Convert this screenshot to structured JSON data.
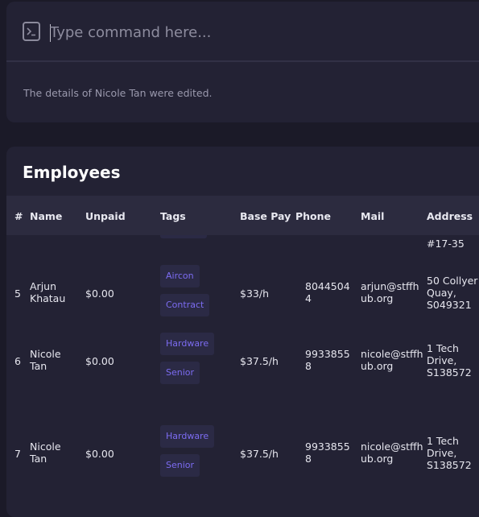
{
  "command": {
    "placeholder": "Type command here...",
    "value": "",
    "result": "The details of Nicole Tan were edited."
  },
  "employees": {
    "title": "Employees",
    "columns": [
      "#",
      "Name",
      "Unpaid",
      "Tags",
      "Base Pay",
      "Phone",
      "Mail",
      "Address"
    ],
    "partial_above": {
      "address_fragment": "#17-35"
    },
    "rows": [
      {
        "index": "5",
        "name": [
          "Arjun",
          "Khatau"
        ],
        "unpaid": "$0.00",
        "tags": [
          "Aircon",
          "Contract"
        ],
        "base_pay": "$33/h",
        "phone": [
          "8044504",
          "4"
        ],
        "mail": [
          "arjun@stffh",
          "ub.org"
        ],
        "address": [
          "50 Collyer",
          "Quay,",
          "S049321"
        ]
      },
      {
        "index": "6",
        "name": [
          "Nicole",
          "Tan"
        ],
        "unpaid": "$0.00",
        "tags": [
          "Hardware",
          "Senior"
        ],
        "base_pay": "$37.5/h",
        "phone": [
          "9933855",
          "8"
        ],
        "mail": [
          "nicole@stffh",
          "ub.org"
        ],
        "address": [
          "1 Tech",
          "Drive,",
          "S138572"
        ]
      },
      {
        "index": "7",
        "name": [
          "Nicole",
          "Tan"
        ],
        "unpaid": "$0.00",
        "tags": [
          "Hardware",
          "Senior"
        ],
        "base_pay": "$37.5/h",
        "phone": [
          "9933855",
          "8"
        ],
        "mail": [
          "nicole@stffh",
          "ub.org"
        ],
        "address": [
          "1 Tech",
          "Drive,",
          "S138572"
        ]
      }
    ]
  },
  "colors": {
    "background": "#1b1a28",
    "panel": "#232234",
    "header": "#2c2b3f",
    "tag_bg": "#2b2a45",
    "tag_text": "#7c6cf2"
  },
  "icons": {
    "command": "terminal-icon"
  }
}
